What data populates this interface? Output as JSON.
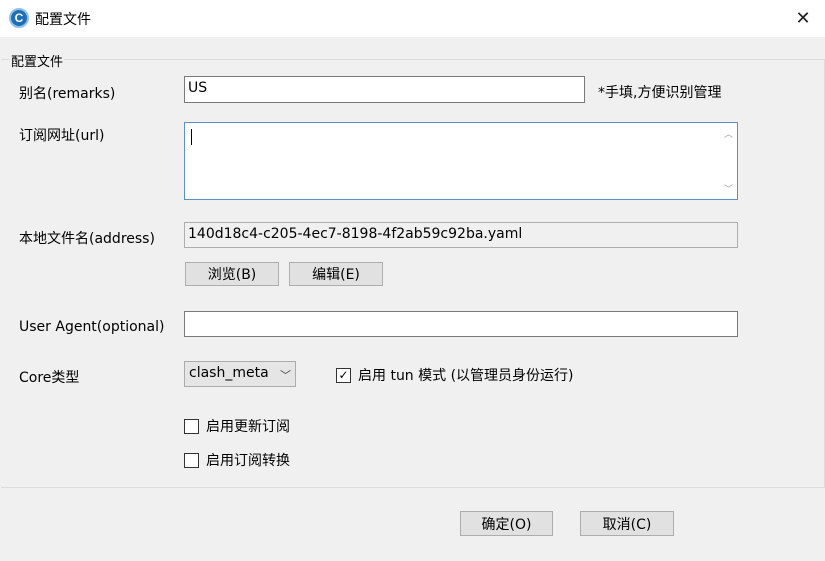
{
  "window": {
    "title": "配置文件",
    "icon_letter": "C",
    "close_glyph": "✕"
  },
  "group": {
    "title": "配置文件"
  },
  "remarks": {
    "label": "别名(remarks)",
    "value": "US",
    "hint": "*手填,方便识别管理"
  },
  "url": {
    "label": "订阅网址(url)",
    "value": ""
  },
  "address": {
    "label": "本地文件名(address)",
    "value": "140d18c4-c205-4ec7-8198-4f2ab59c92ba.yaml",
    "browse_label": "浏览(B)",
    "edit_label": "编辑(E)"
  },
  "user_agent": {
    "label": "User Agent(optional)",
    "value": ""
  },
  "core": {
    "label": "Core类型",
    "selected": "clash_meta",
    "tun_checked": true,
    "tun_label": "启用 tun 模式 (以管理员身份运行)"
  },
  "options": {
    "update_label": "启用更新订阅",
    "update_checked": false,
    "convert_label": "启用订阅转换",
    "convert_checked": false
  },
  "footer": {
    "ok_label": "确定(O)",
    "cancel_label": "取消(C)"
  }
}
